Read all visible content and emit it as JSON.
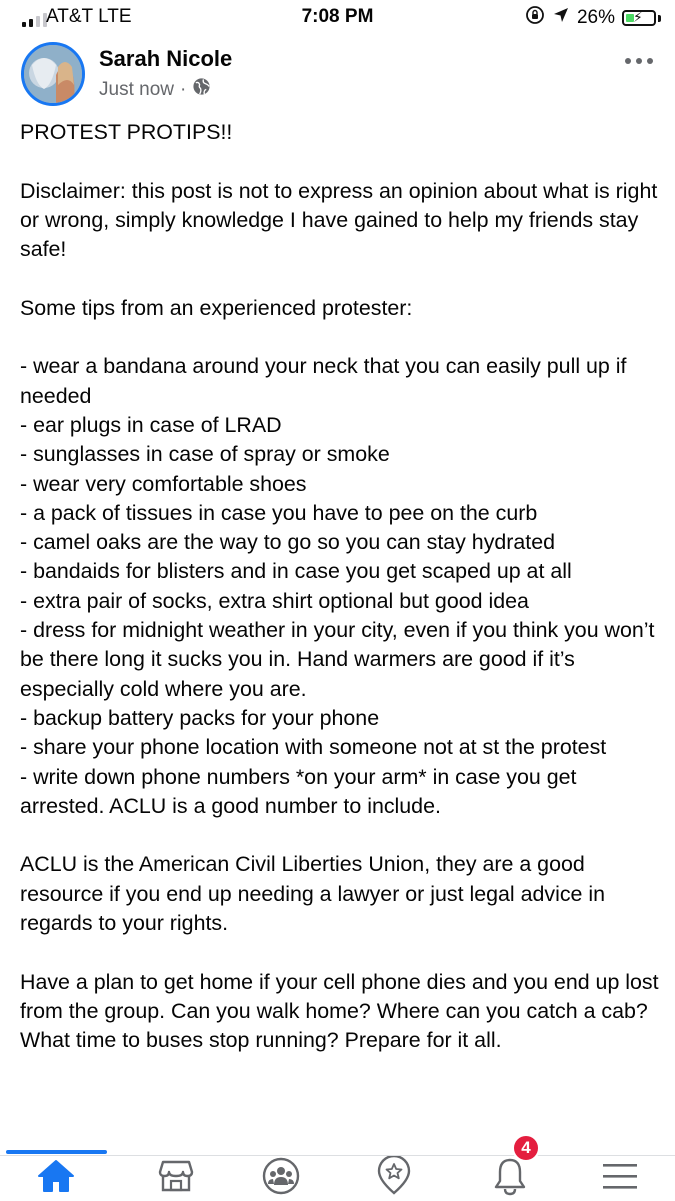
{
  "status_bar": {
    "carrier": "AT&T  LTE",
    "time": "7:08 PM",
    "battery_percent": "26%",
    "battery_level": 0.26
  },
  "post": {
    "author": "Sarah Nicole",
    "timestamp": "Just now",
    "separator": "·",
    "paragraphs": [
      "PROTEST PROTIPS!!",
      "",
      "Disclaimer: this post is not to express an opinion about what is right or wrong, simply knowledge I have gained to help my friends stay safe!",
      "",
      "Some tips from an experienced protester:",
      "",
      "- wear a bandana around your neck that you can easily pull up if needed",
      "- ear plugs in case of LRAD",
      "- sunglasses in case of spray or smoke",
      "- wear very comfortable shoes",
      "- a pack of tissues in case you have to pee on the curb",
      "- camel oaks are the way to go so you can stay hydrated",
      "- bandaids for blisters and in case you get scaped up at all",
      "- extra pair of socks, extra shirt optional but good idea",
      "- dress for midnight weather in your city, even if you think you won’t be there long it sucks you in. Hand warmers are good if it’s especially cold where you are.",
      "- backup battery packs for your phone",
      "- share your phone location with someone not at st the protest",
      "- write down phone numbers *on your arm* in case you get arrested. ACLU is a good number to include.",
      "",
      "ACLU is the American Civil Liberties Union, they are a good resource if you end up needing a lawyer or just legal advice in regards to your rights.",
      "",
      "Have a plan to get home if your cell phone dies and you end up lost from the group. Can you walk home? Where can you catch a cab? What time to buses stop running? Prepare for it all."
    ]
  },
  "tabbar": {
    "tabs": [
      {
        "icon": "home-icon",
        "active": true
      },
      {
        "icon": "marketplace-icon",
        "active": false
      },
      {
        "icon": "groups-icon",
        "active": false
      },
      {
        "icon": "dating-icon",
        "active": false
      },
      {
        "icon": "bell-icon",
        "active": false
      },
      {
        "icon": "menu-icon",
        "active": false
      }
    ],
    "notification_count": "4"
  },
  "colors": {
    "accent": "#1877f2",
    "badge": "#e41e3f",
    "icon_gray": "#65676b",
    "battery_green": "#4cd964"
  }
}
